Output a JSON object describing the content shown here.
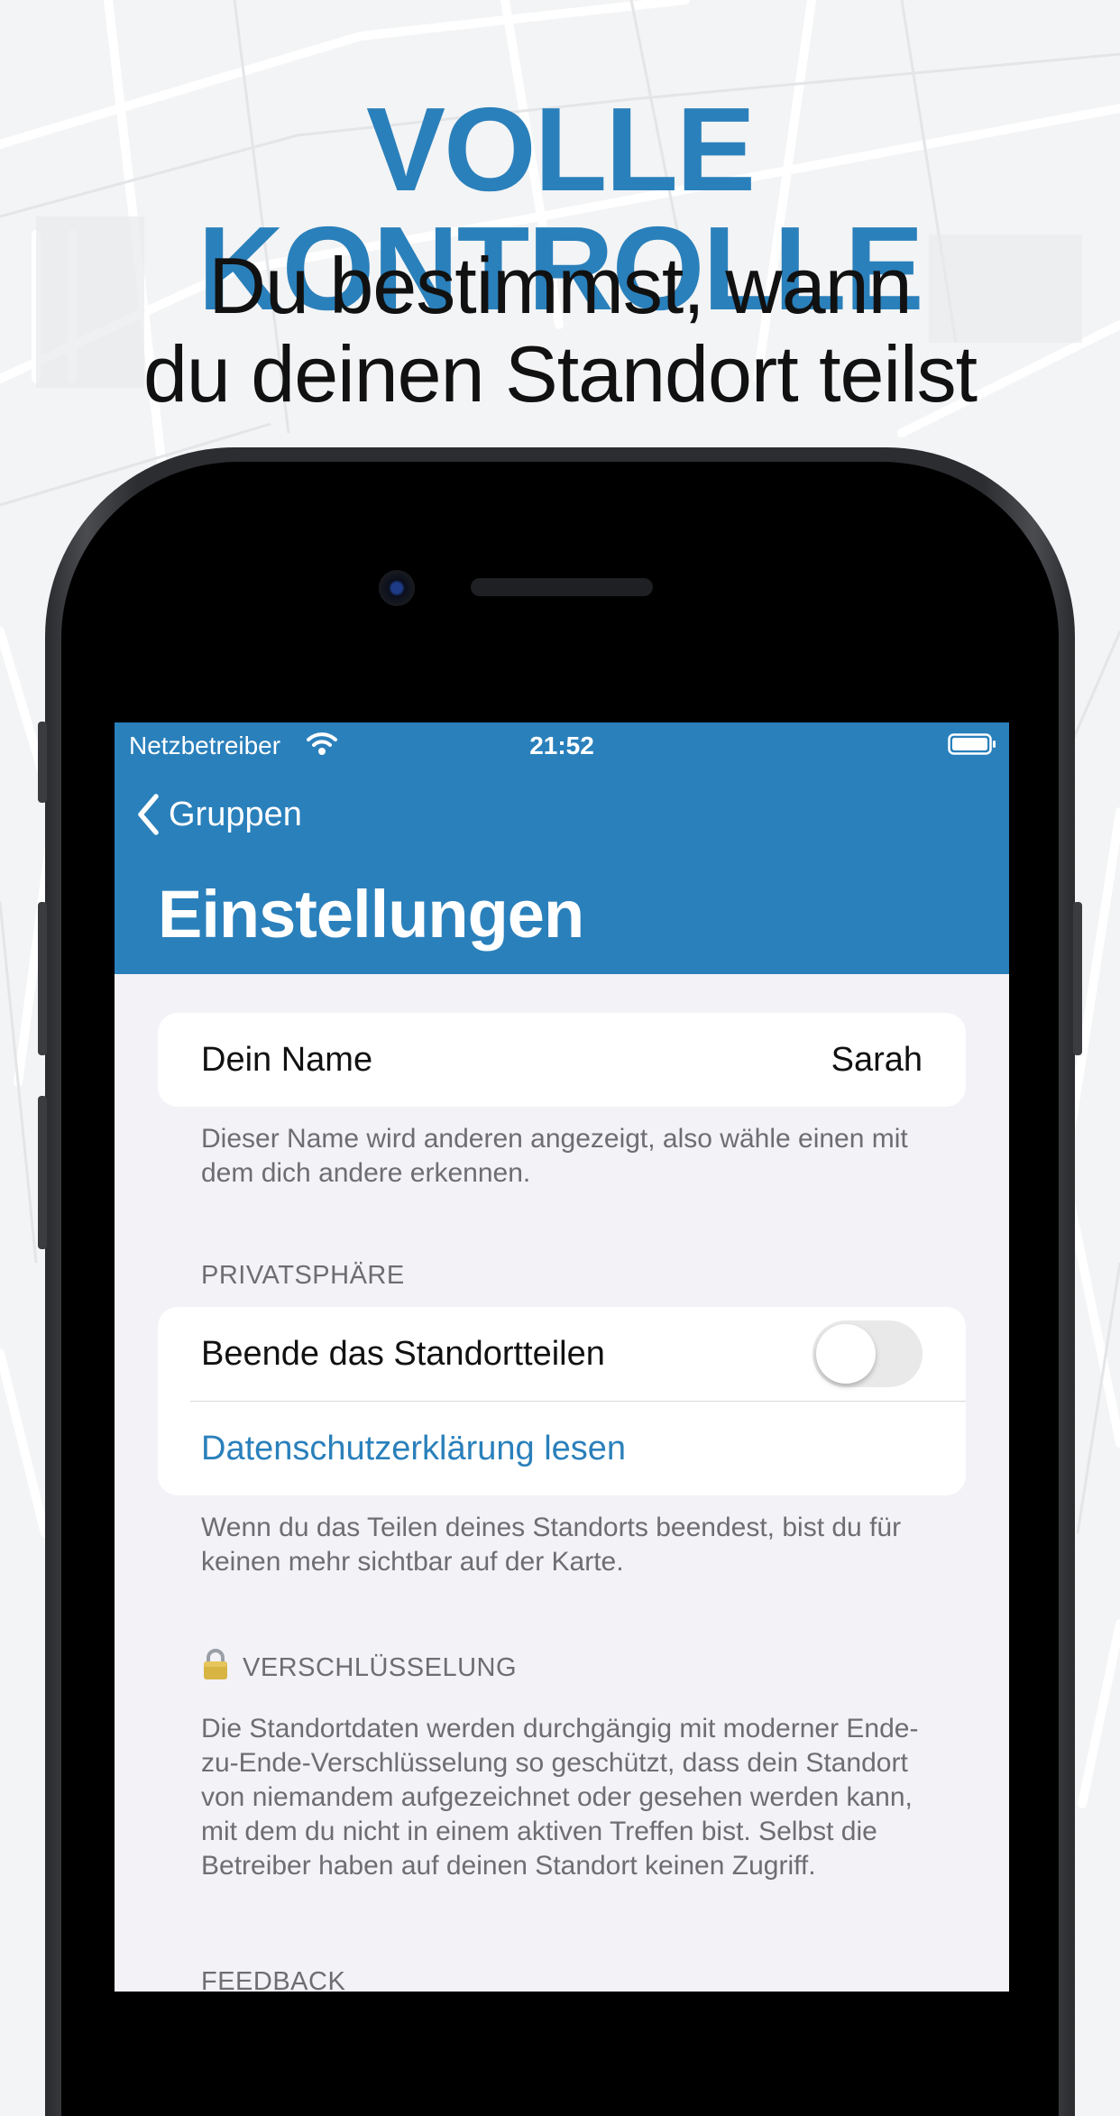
{
  "promo": {
    "headline": "VOLLE KONTROLLE",
    "subline_1": "Du bestimmst, wann",
    "subline_2": "du deinen Standort teilst"
  },
  "colors": {
    "brand": "#2a80bb",
    "background": "#f2f2f7"
  },
  "status_bar": {
    "carrier": "Netzbetreiber",
    "time": "21:52"
  },
  "nav": {
    "back_label": "Gruppen",
    "title": "Einstellungen"
  },
  "name_section": {
    "label": "Dein Name",
    "value": "Sarah",
    "footer": "Dieser Name wird anderen angezeigt, also wähle einen mit dem dich andere erkennen."
  },
  "privacy_section": {
    "header": "PRIVATSPHÄRE",
    "toggle_label": "Beende das Standortteilen",
    "toggle_on": false,
    "link_label": "Datenschutzerklärung lesen",
    "footer": "Wenn du das Teilen deines Standorts beendest, bist du für keinen mehr sichtbar auf der Karte."
  },
  "encryption_section": {
    "icon": "lock-icon",
    "header": "VERSCHLÜSSELUNG",
    "footer": "Die Standortdaten werden durchgängig mit moderner Ende-zu-Ende-Verschlüsselung so geschützt, dass dein Standort von niemandem aufgezeichnet oder gesehen werden kann, mit dem du nicht in einem aktiven Treffen bist. Selbst die Betreiber haben auf deinen Standort keinen Zugriff."
  },
  "feedback_section": {
    "header": "FEEDBACK"
  }
}
